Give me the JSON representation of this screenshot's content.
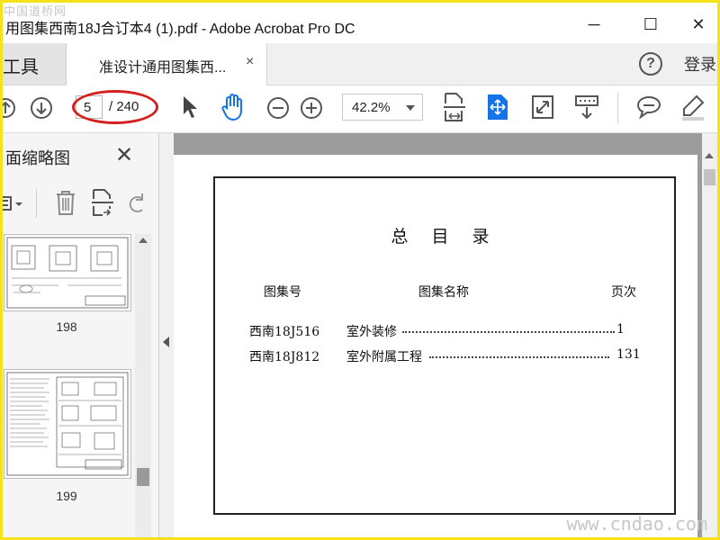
{
  "window": {
    "title": "用图集西南18J合订本4 (1).pdf - Adobe Acrobat Pro DC",
    "minimize": "─",
    "maximize": "☐",
    "close": "✕"
  },
  "watermarks": {
    "top": "中国道桥网",
    "bottom": "www.cndao.com"
  },
  "tabs": {
    "tools_label": "工具",
    "doc_label": "准设计通用图集西...",
    "doc_close": "×",
    "help": "?",
    "login": "登录"
  },
  "toolbar": {
    "current_page": "5",
    "total_pages": "/ 240",
    "zoom": "42.2%"
  },
  "sidebar": {
    "title": "面缩略图",
    "close": "✕",
    "thumbnails": [
      {
        "label": "198"
      },
      {
        "label": "199"
      }
    ]
  },
  "document": {
    "heading": "总 目 录",
    "columns": {
      "id": "图集号",
      "name": "图集名称",
      "page": "页次"
    },
    "rows": [
      {
        "id": "西南18J516",
        "name": "室外装修",
        "page": "1"
      },
      {
        "id": "西南18J812",
        "name": "室外附属工程",
        "page": "131"
      }
    ]
  },
  "colors": {
    "frame": "#f4e21a",
    "annotation_ring": "#d51f1f",
    "acrobat_blue": "#1473e6"
  }
}
